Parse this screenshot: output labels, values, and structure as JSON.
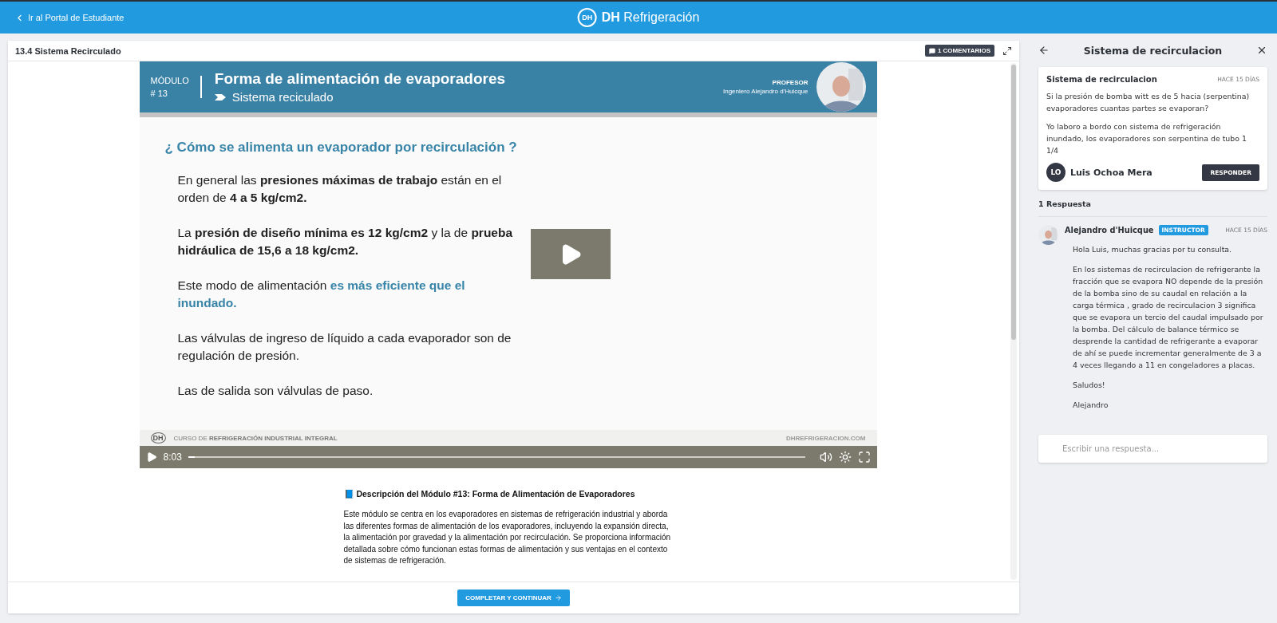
{
  "topbar": {
    "back_link": "Ir al Portal de Estudiante",
    "logo_mark": "DH",
    "brand": "**DH** Refrigeración"
  },
  "lesson": {
    "title": "13.4 Sistema Recirculado",
    "comments_button": "1 COMENTARIOS"
  },
  "slide": {
    "module_label": "MÓDULO",
    "module_number": "# 13",
    "title": "Forma de alimentación de evaporadores",
    "subtitle": "Sistema reciculado",
    "teacher_label": "PROFESOR",
    "teacher_name": "Ingeniero Alejandro d'Huicque",
    "question": "¿ Cómo se alimenta un evaporador por recirculación ?",
    "paragraphs": [
      "En general las **presiones máximas de trabajo** están en el orden de **4 a 5 kg/cm2.**",
      "La **presión de diseño mínima es 12 kg/cm2** y la de **prueba hidráulica de 15,6 a 18 kg/cm2.**",
      "Este modo de alimentación *es más eficiente que el inundado.*",
      "Las válvulas de ingreso de líquido a cada evaporador son de regulación de presión.",
      "Las de salida son válvulas de paso."
    ],
    "footer_mark": "DH",
    "footer_text": "CURSO DE **REFRIGERACIÓN INDUSTRIAL INTEGRAL**",
    "footer_site": "DHREFRIGERACION.COM"
  },
  "player": {
    "time": "8:03",
    "level": 0.01
  },
  "description": {
    "title": "📘 Descripción del Módulo #13: Forma de Alimentación de Evaporadores",
    "body": "Este módulo se centra en los evaporadores en sistemas de refrigeración industrial y aborda las diferentes formas de alimentación de los evaporadores, incluyendo la expansión directa, la alimentación por gravedad y la alimentación por recirculación. Se proporciona información detallada sobre cómo funcionan estas formas de alimentación y sus ventajas en el contexto de sistemas de refrigeración."
  },
  "continue_button": "COMPLETAR Y CONTINUAR",
  "panel": {
    "title": "Sistema de recirculacion",
    "question": {
      "title": "Sistema de recirculacion",
      "time": "HACE 15 DÍAS",
      "paragraphs": [
        "Si la presión de bomba witt es de 5 hacia (serpentina) evaporadores cuantas partes se evaporan?",
        "Yo laboro a bordo con sistema de refrigeración inundado, los evaporadores son serpentina de tubo 1 1/4"
      ],
      "author_initials": "LO",
      "author": "Luis Ochoa Mera",
      "reply_button": "RESPONDER"
    },
    "replies_count": "1 Respuesta",
    "replies": [
      {
        "author": "Alejandro d'Huicque",
        "badge": "INSTRUCTOR",
        "time": "HACE 15 DÍAS",
        "paragraphs": [
          "Hola Luis, muchas gracias por tu consulta.",
          "En los sistemas de recirculacion de refrigerante la fracción que se evapora NO depende de la presión de la bomba sino de su caudal en relación a la carga térmica , grado de recirculacion 3 significa que se evapora un tercio del caudal impulsado por la bomba. Del cálculo de balance térmico se desprende la cantidad de refrigerante a evaporar de ahí se puede incrementar generalmente de 3 a 4 veces llegando a 11 en congeladores a placas.",
          "Saludos!",
          "Alejandro"
        ]
      }
    ],
    "reply_placeholder": "Escribir una respuesta..."
  }
}
